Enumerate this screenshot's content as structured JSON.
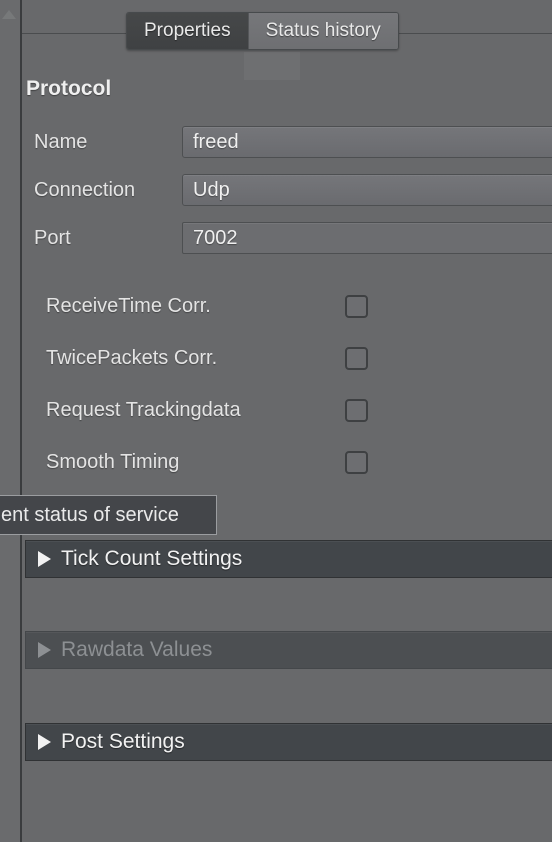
{
  "colors": {
    "background": "#68696b",
    "section_header": "#42464a",
    "section_header_disabled": "#4c4f52",
    "field_background": "#6c6d70",
    "text": "#e8e8e8",
    "text_disabled": "#8d9093",
    "tooltip_background": "#44464a",
    "tooltip_border": "#9b9da0",
    "tab_selected": "#424446",
    "tab_unselected": "#747578"
  },
  "tabs": [
    {
      "label": "Properties",
      "selected": true
    },
    {
      "label": "Status history",
      "selected": false
    }
  ],
  "group": {
    "heading": "Protocol"
  },
  "fields": [
    {
      "label": "Name",
      "value": "freed",
      "control": "combobox",
      "spinner_icon": "spinner-up-down-icon"
    },
    {
      "label": "Connection",
      "value": "Udp",
      "control": "combobox",
      "spinner_icon": "spinner-up-down-icon"
    },
    {
      "label": "Port",
      "value": "7002",
      "control": "textbox",
      "spinner_icon": ""
    }
  ],
  "checkboxes": [
    {
      "label": "ReceiveTime Corr.",
      "checked": false
    },
    {
      "label": "TwicePackets Corr.",
      "checked": false
    },
    {
      "label": "Request Trackingdata",
      "checked": false
    },
    {
      "label": "Smooth Timing",
      "checked": false
    }
  ],
  "tooltip": {
    "text": "ent status of service",
    "clipped": true
  },
  "sections": [
    {
      "label": "Tick Count Settings",
      "expanded": false,
      "enabled": true,
      "arrow_icon": "triangle-right-icon"
    },
    {
      "label": "Rawdata Values",
      "expanded": false,
      "enabled": false,
      "arrow_icon": "triangle-right-icon"
    },
    {
      "label": "Post Settings",
      "expanded": false,
      "enabled": true,
      "arrow_icon": "triangle-right-icon"
    }
  ]
}
